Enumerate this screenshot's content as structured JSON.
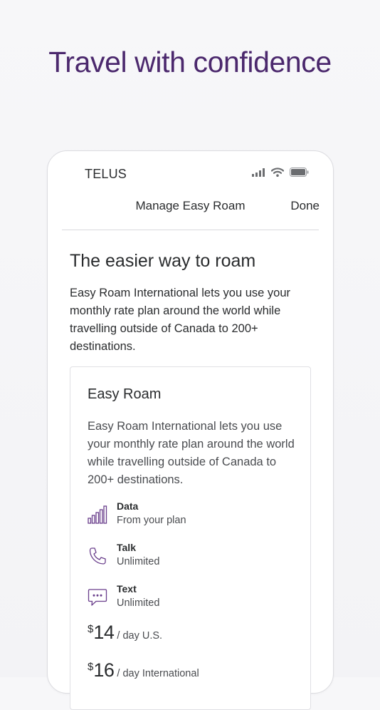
{
  "headline": "Travel with confidence",
  "status_bar": {
    "carrier": "TELUS",
    "icons": [
      "signal-icon",
      "wifi-icon",
      "battery-icon"
    ]
  },
  "navbar": {
    "title": "Manage Easy Roam",
    "done_label": "Done"
  },
  "content": {
    "title": "The easier way to roam",
    "description": "Easy Roam International lets you use your monthly rate plan around the world while travelling outside of Canada to 200+ destinations."
  },
  "card": {
    "title": "Easy Roam",
    "description": "Easy Roam International lets you use your monthly rate plan around the world while travelling outside of Canada to 200+ destinations.",
    "features": [
      {
        "icon": "data-bars-icon",
        "label": "Data",
        "value": "From your plan"
      },
      {
        "icon": "phone-icon",
        "label": "Talk",
        "value": "Unlimited"
      },
      {
        "icon": "chat-bubble-icon",
        "label": "Text",
        "value": "Unlimited"
      }
    ],
    "prices": [
      {
        "symbol": "$",
        "amount": "14",
        "per": "/ day U.S."
      },
      {
        "symbol": "$",
        "amount": "16",
        "per": "/ day International"
      }
    ]
  },
  "colors": {
    "brand_purple": "#4b286d",
    "icon_purple": "#6a3f8c",
    "text": "#2a2c2e"
  }
}
